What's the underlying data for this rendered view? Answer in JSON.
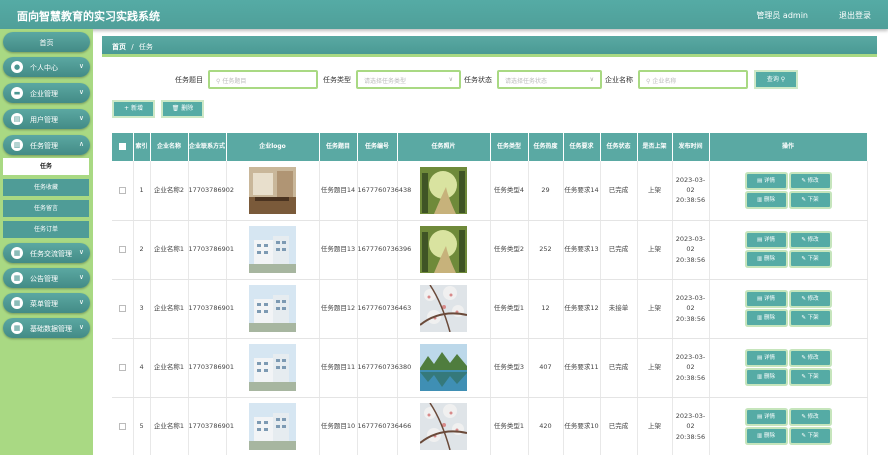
{
  "header": {
    "title": "面向智慧教育的实习实践系统",
    "user": "管理员 admin",
    "logout": "退出登录"
  },
  "sidebar": {
    "home": "首页",
    "items": [
      {
        "label": "个人中心",
        "icon": "person-icon"
      },
      {
        "label": "企业管理",
        "icon": "company-icon"
      },
      {
        "label": "用户管理",
        "icon": "users-icon"
      },
      {
        "label": "任务管理",
        "icon": "chart-icon",
        "chevron": "∧"
      },
      {
        "label": "任务交流管理",
        "icon": "grid-icon"
      },
      {
        "label": "公告管理",
        "icon": "grid-icon"
      },
      {
        "label": "菜单管理",
        "icon": "grid-icon"
      },
      {
        "label": "基础数据管理",
        "icon": "grid-icon"
      }
    ],
    "subitems": [
      "任务",
      "任务收藏",
      "任务留言",
      "任务订单"
    ]
  },
  "breadcrumb": {
    "home": "首页",
    "sep": "/",
    "current": "任务"
  },
  "search": {
    "fields": [
      {
        "label": "任务题目",
        "placeholder": "任务题目",
        "icon": "search-icon"
      },
      {
        "label": "任务类型",
        "placeholder": "请选择任务类型",
        "icon": "chevron-down-icon"
      },
      {
        "label": "任务状态",
        "placeholder": "请选择任务状态",
        "icon": "chevron-down-icon"
      },
      {
        "label": "企业名称",
        "placeholder": "企业名称",
        "icon": "search-icon"
      }
    ],
    "button": "查询"
  },
  "toolbar": {
    "add": "+ 新增",
    "delete": "删除"
  },
  "table": {
    "headers": [
      "索引",
      "企业名称",
      "企业联系方式",
      "企业logo",
      "任务题目",
      "任务编号",
      "任务照片",
      "任务类型",
      "任务热度",
      "任务要求",
      "任务状态",
      "是否上架",
      "发布时间",
      "操作"
    ],
    "rows": [
      {
        "idx": "1",
        "company": "企业名称2",
        "phone": "17703786902",
        "title": "任务题目14",
        "no": "1677760736438",
        "type": "任务类型4",
        "heat": "29",
        "req": "任务要求14",
        "status": "已完成",
        "shelf": "上架",
        "time": "2023-03-02 20:38:56",
        "logo": "lobby",
        "photo": "path"
      },
      {
        "idx": "2",
        "company": "企业名称1",
        "phone": "17703786901",
        "title": "任务题目13",
        "no": "1677760736396",
        "type": "任务类型2",
        "heat": "252",
        "req": "任务要求13",
        "status": "已完成",
        "shelf": "上架",
        "time": "2023-03-02 20:38:56",
        "logo": "building",
        "photo": "path"
      },
      {
        "idx": "3",
        "company": "企业名称1",
        "phone": "17703786901",
        "title": "任务题目12",
        "no": "1677760736463",
        "type": "任务类型1",
        "heat": "12",
        "req": "任务要求12",
        "status": "未接单",
        "shelf": "上架",
        "time": "2023-03-02 20:38:56",
        "logo": "building",
        "photo": "blossom"
      },
      {
        "idx": "4",
        "company": "企业名称1",
        "phone": "17703786901",
        "title": "任务题目11",
        "no": "1677760736380",
        "type": "任务类型3",
        "heat": "407",
        "req": "任务要求11",
        "status": "已完成",
        "shelf": "上架",
        "time": "2023-03-02 20:38:56",
        "logo": "building",
        "photo": "lake"
      },
      {
        "idx": "5",
        "company": "企业名称1",
        "phone": "17703786901",
        "title": "任务题目10",
        "no": "1677760736466",
        "type": "任务类型1",
        "heat": "420",
        "req": "任务要求10",
        "status": "已完成",
        "shelf": "上架",
        "time": "2023-03-02 20:38:56",
        "logo": "building",
        "photo": "blossom"
      }
    ],
    "actions": {
      "detail": "详情",
      "edit": "修改",
      "delete": "删除",
      "offshelf": "下架"
    }
  },
  "colors": {
    "primary": "#55aba5",
    "sidebar_bg": "#a9d983",
    "border_green": "#a9d983"
  }
}
